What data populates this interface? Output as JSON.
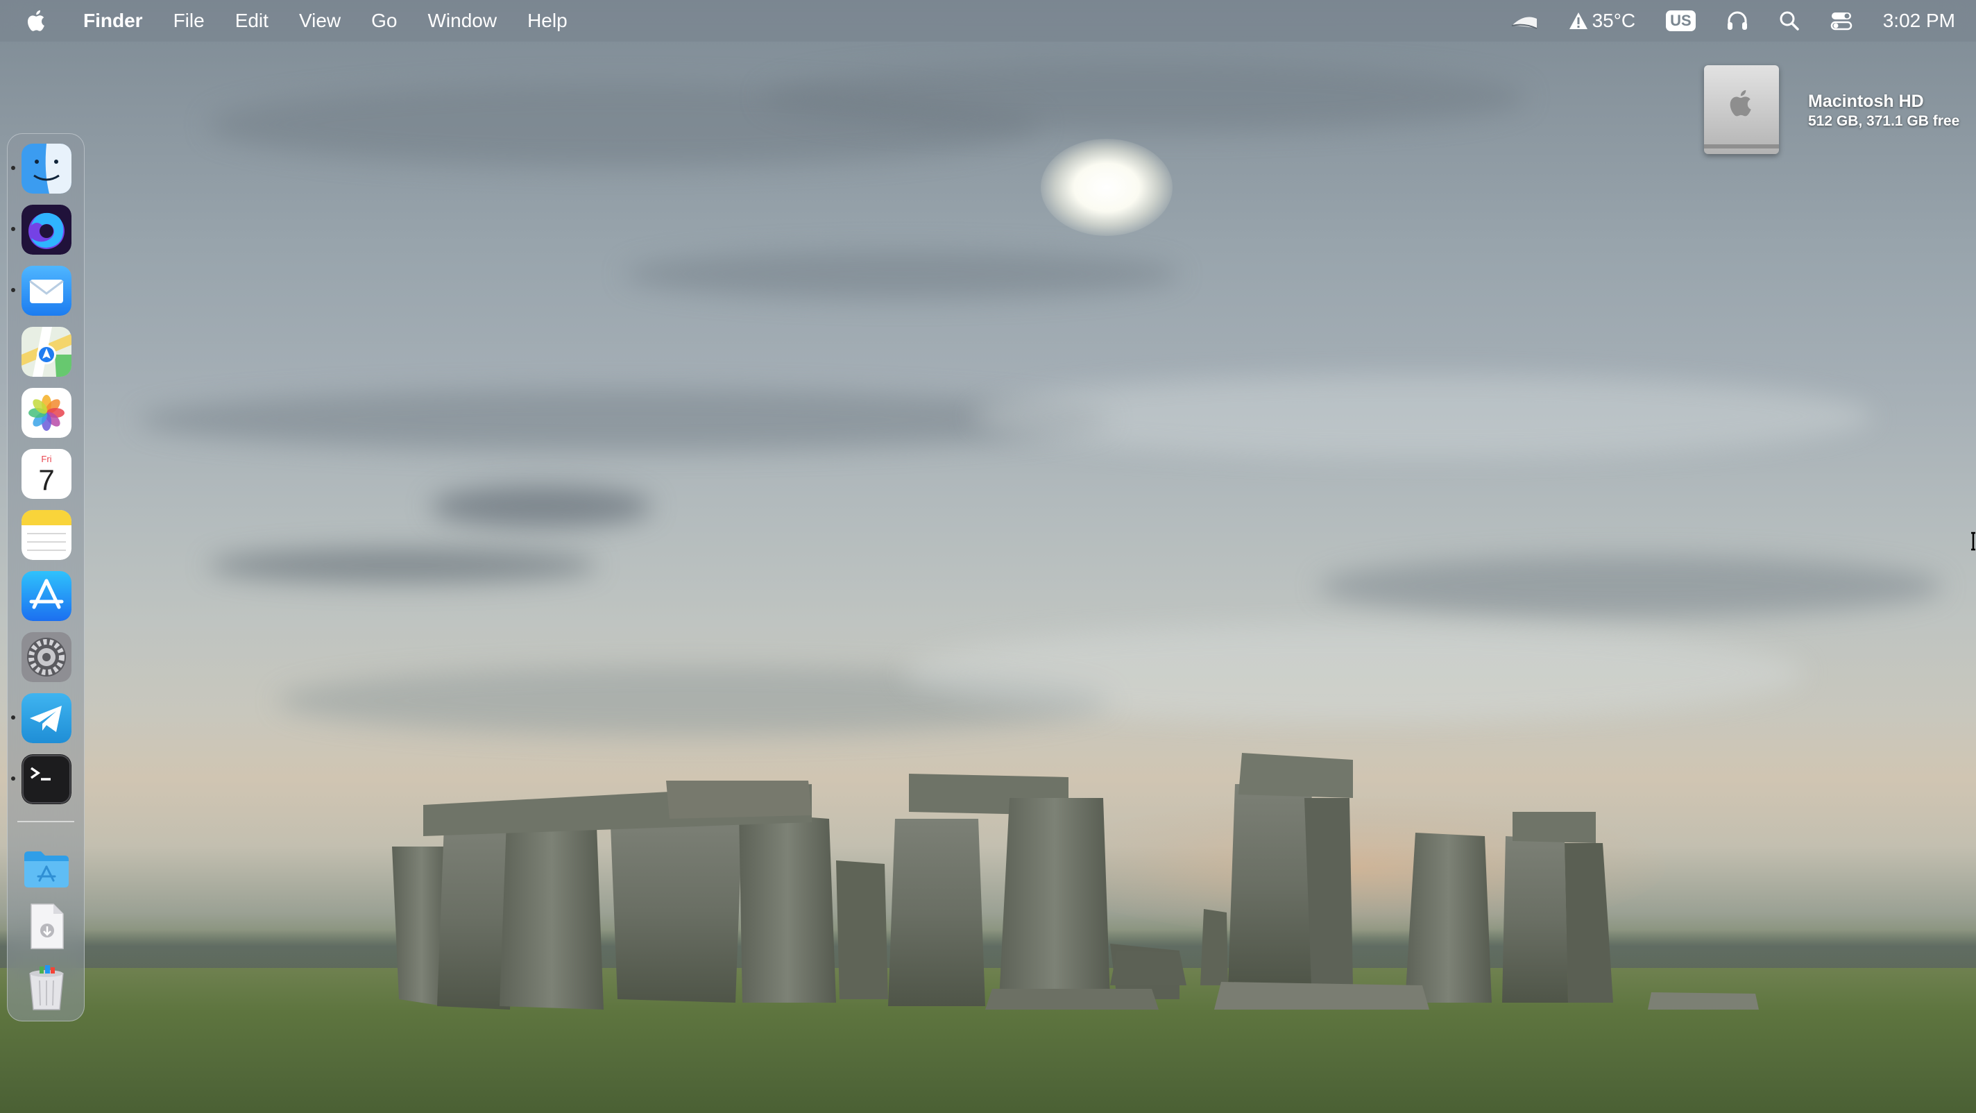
{
  "menubar": {
    "apple_icon": "apple-logo-icon",
    "app_name": "Finder",
    "items": [
      {
        "label": "File"
      },
      {
        "label": "Edit"
      },
      {
        "label": "View"
      },
      {
        "label": "Go"
      },
      {
        "label": "Window"
      },
      {
        "label": "Help"
      }
    ],
    "status": {
      "wifi_icon": "wifi-icon",
      "weather_icon": "warning-triangle-icon",
      "weather_temp": "35°C",
      "keyboard_layout": "US",
      "headphones_icon": "headphones-icon",
      "search_icon": "spotlight-search-icon",
      "control_center_icon": "control-center-icon",
      "clock": "3:02 PM"
    }
  },
  "desktop": {
    "drive": {
      "name": "Macintosh HD",
      "info": "512 GB, 371.1 GB free",
      "icon": "hard-drive-icon"
    }
  },
  "dock": {
    "apps": [
      {
        "name": "Finder",
        "icon": "finder-icon",
        "running": true
      },
      {
        "name": "Firefox",
        "icon": "firefox-icon",
        "running": true
      },
      {
        "name": "Mail",
        "icon": "mail-icon",
        "running": true
      },
      {
        "name": "Maps",
        "icon": "maps-icon",
        "running": false
      },
      {
        "name": "Photos",
        "icon": "photos-icon",
        "running": false
      },
      {
        "name": "Calendar",
        "icon": "calendar-icon",
        "running": false,
        "day": "Fri",
        "date": "7"
      },
      {
        "name": "Notes",
        "icon": "notes-icon",
        "running": false
      },
      {
        "name": "App Store",
        "icon": "app-store-icon",
        "running": false
      },
      {
        "name": "System Settings",
        "icon": "settings-gear-icon",
        "running": false
      },
      {
        "name": "Telegram",
        "icon": "telegram-icon",
        "running": true
      },
      {
        "name": "Terminal",
        "icon": "terminal-icon",
        "running": true
      }
    ],
    "stacks": [
      {
        "name": "Applications",
        "icon": "applications-folder-icon"
      },
      {
        "name": "Downloads",
        "icon": "downloads-icon"
      },
      {
        "name": "Trash",
        "icon": "trash-icon"
      }
    ]
  },
  "colors": {
    "menubar_text": "#ffffff",
    "dock_background": "#8c969e"
  }
}
